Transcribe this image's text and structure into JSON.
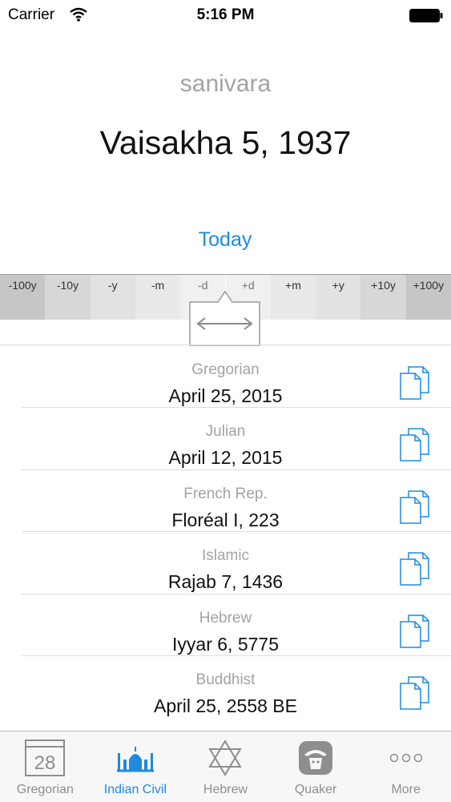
{
  "status_bar": {
    "carrier": "Carrier",
    "time": "5:16 PM"
  },
  "header": {
    "weekday": "sanivara",
    "date": "Vaisakha 5, 1937",
    "today_label": "Today"
  },
  "adjust_buttons": [
    {
      "label": "-100y",
      "color": "#c6c6c6"
    },
    {
      "label": "-10y",
      "color": "#d7d7d7"
    },
    {
      "label": "-y",
      "color": "#e2e2e2"
    },
    {
      "label": "-m",
      "color": "#e9e9e9"
    },
    {
      "label": "-d",
      "color": "#f0f0f0"
    },
    {
      "label": "+d",
      "color": "#f0f0f0"
    },
    {
      "label": "+m",
      "color": "#e9e9e9"
    },
    {
      "label": "+y",
      "color": "#e2e2e2"
    },
    {
      "label": "+10y",
      "color": "#d7d7d7"
    },
    {
      "label": "+100y",
      "color": "#c6c6c6"
    }
  ],
  "conversions": [
    {
      "calendar": "Gregorian",
      "value": "April 25, 2015"
    },
    {
      "calendar": "Julian",
      "value": "April 12, 2015"
    },
    {
      "calendar": "French Rep.",
      "value": "Floréal I, 223"
    },
    {
      "calendar": "Islamic",
      "value": "Rajab 7, 1436"
    },
    {
      "calendar": "Hebrew",
      "value": "Iyyar 6, 5775"
    },
    {
      "calendar": "Buddhist",
      "value": "April 25, 2558 BE"
    }
  ],
  "tabs": [
    {
      "label": "Gregorian",
      "icon": "calendar-icon",
      "icon_text": "28",
      "active": false
    },
    {
      "label": "Indian Civil",
      "icon": "taj-mahal-icon",
      "active": true
    },
    {
      "label": "Hebrew",
      "icon": "star-of-david-icon",
      "active": false
    },
    {
      "label": "Quaker",
      "icon": "quaker-icon",
      "active": false
    },
    {
      "label": "More",
      "icon": "more-icon",
      "active": false
    }
  ],
  "colors": {
    "accent": "#1f8ae0",
    "muted_text": "#a3a3a3",
    "inactive_tab": "#8e8e8e"
  }
}
